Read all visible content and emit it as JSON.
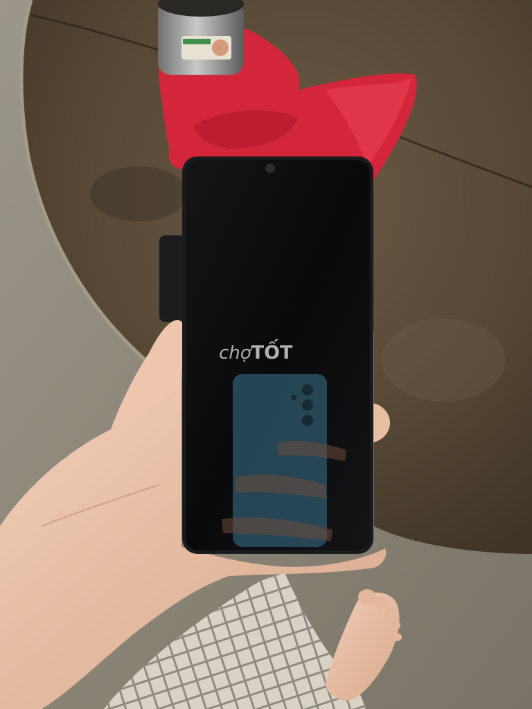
{
  "photo": {
    "watermark": {
      "part1": "chợ",
      "part2": "TỐT"
    }
  },
  "colors": {
    "floor": "#8a8476",
    "table_wood": "#5a4d3b",
    "cloth_red": "#d92a3e",
    "phone_screen": "#0b0b0d",
    "phone_reflection": "#2f5a6f",
    "skin": "#e6bfa6",
    "pants": "#cfcabd"
  }
}
